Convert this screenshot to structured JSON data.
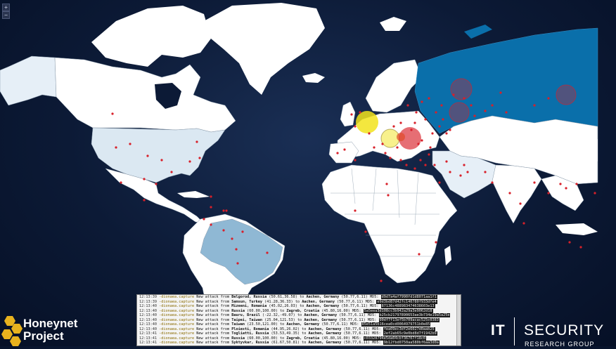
{
  "zoom": {
    "in_label": "+",
    "out_label": "−"
  },
  "colors": {
    "ocean": "#0c1a36",
    "land": "#ffffff",
    "russia": "#0a6faa",
    "brazil": "#8fb8d4",
    "usa": "#dbe8f2",
    "light": "#e6eff7",
    "attack_dot": "#d8202a",
    "germany_hotspot": "#f2e31c"
  },
  "log": {
    "rows": [
      {
        "time": "12:13:39",
        "source": "-dionaea.capture",
        "text": "New attack from",
        "from": "Belgorod, Russia",
        "from_coords": "(50.61,36.58)",
        "to_word": "to",
        "to": "Aachen, Germany",
        "to_coords": "(50.77,6.11)",
        "md5_label": "MD5:",
        "md5": "d9d7a4af7990fd1d8071aa1f1"
      },
      {
        "time": "12:13:39",
        "source": "-dionaea.capture",
        "text": "New attack from",
        "from": "Samsun, Turkey",
        "from_coords": "(41.28,36.33)",
        "to_word": "to",
        "to": "Aachen, Germany",
        "to_coords": "(50.77,6.11)",
        "md5_label": "MD5:",
        "md5": "e9d3bd87d42fc140780f933dfe4"
      },
      {
        "time": "12:13:40",
        "source": "-dionaea.capture",
        "text": "New attack from",
        "from": "Mizeeni, Romania",
        "from_coords": "(45.02,26.03)",
        "to_word": "to",
        "to": "Aachen, Germany",
        "to_coords": "(50.77,6.11)",
        "md5_label": "MD5:",
        "md5": "87136c488983474638603e13"
      },
      {
        "time": "12:13:40",
        "source": "-dionaea.capture",
        "text": "New attack from",
        "from": "Russia",
        "from_coords": "(60.00,100.00)",
        "to_word": "to",
        "to": "Zagreb, Croatia",
        "to_coords": "(45.80,16.00)",
        "md5_label": "MD5:",
        "md5": "5a5eea3d108cc3b942a29a3e9062d18"
      },
      {
        "time": "12:13:40",
        "source": "-dionaea.capture",
        "text": "New attack from",
        "from": "Bauru, Brazil",
        "from_coords": "(-22.32,-49.07)",
        "to_word": "to",
        "to": "Aachen, Germany",
        "to_coords": "(50.77,6.11)",
        "md5_label": "MD5:",
        "md5": "b25cb21797890653ae3b734e19a5a25e"
      },
      {
        "time": "12:13:40",
        "source": "-dionaea.capture",
        "text": "New attack from",
        "from": "Taipei, Taiwan",
        "from_coords": "(25.04,121.53)",
        "to_word": "to",
        "to": "Aachen, Germany",
        "to_coords": "(50.77,6.11)",
        "md5_label": "MD5:",
        "md5": "90df7f13ef5b709acac525c0383"
      },
      {
        "time": "12:13:40",
        "source": "-dionaea.capture",
        "text": "New attack from",
        "from": "Taiwan",
        "from_coords": "(23.50,121.00)",
        "to_word": "to",
        "to": "Aachen, Germany",
        "to_coords": "(50.77,6.11)",
        "md5_label": "MD5:",
        "md5": "85e51a5b16cea0cd0064979751b0e85"
      },
      {
        "time": "12:13:40",
        "source": "-dionaea.capture",
        "text": "New attack from",
        "from": "Ploiesti, Romania",
        "from_coords": "(44.95,26.02)",
        "to_word": "to",
        "to": "Aachen, Germany",
        "to_coords": "(50.77,6.11)",
        "md5_label": "MD5:",
        "md5": "fea09ec3df2e6027d0aab25"
      },
      {
        "time": "12:13:41",
        "source": "-dionaea.capture",
        "text": "New attack from",
        "from": "Togliatti, Russia",
        "from_coords": "(53.53,49.35)",
        "to_word": "to",
        "to": "Aachen, Germany",
        "to_coords": "(50.77,6.11)",
        "md5_label": "MD5:",
        "md5": "2ef2ab65c9e0bd8d7f1942b9"
      },
      {
        "time": "12:13:41",
        "source": "-dionaea.capture",
        "text": "New attack from",
        "from": "Russia",
        "from_coords": "(60.00,100.00)",
        "to_word": "to",
        "to": "Zagreb, Croatia",
        "to_coords": "(45.80,16.00)",
        "md5_label": "MD5:",
        "md5": "c03328794e5da04cbf36707f18c0"
      },
      {
        "time": "12:13:41",
        "source": "-dionaea.capture",
        "text": "New attack from",
        "from": "Syktyvkar, Russia",
        "from_coords": "(61.67,50.81)",
        "to_word": "to",
        "to": "Aachen, Germany",
        "to_coords": "(50.77,6.11)",
        "md5_label": "MD5:",
        "md5": "9b12fbd0750aa580bf6aa3d0a"
      }
    ]
  },
  "branding": {
    "honeynet_line1": "Honeynet",
    "honeynet_line2": "Project",
    "it": "IT",
    "security": "SECURITY",
    "research_group": "RESEARCH GROUP"
  }
}
